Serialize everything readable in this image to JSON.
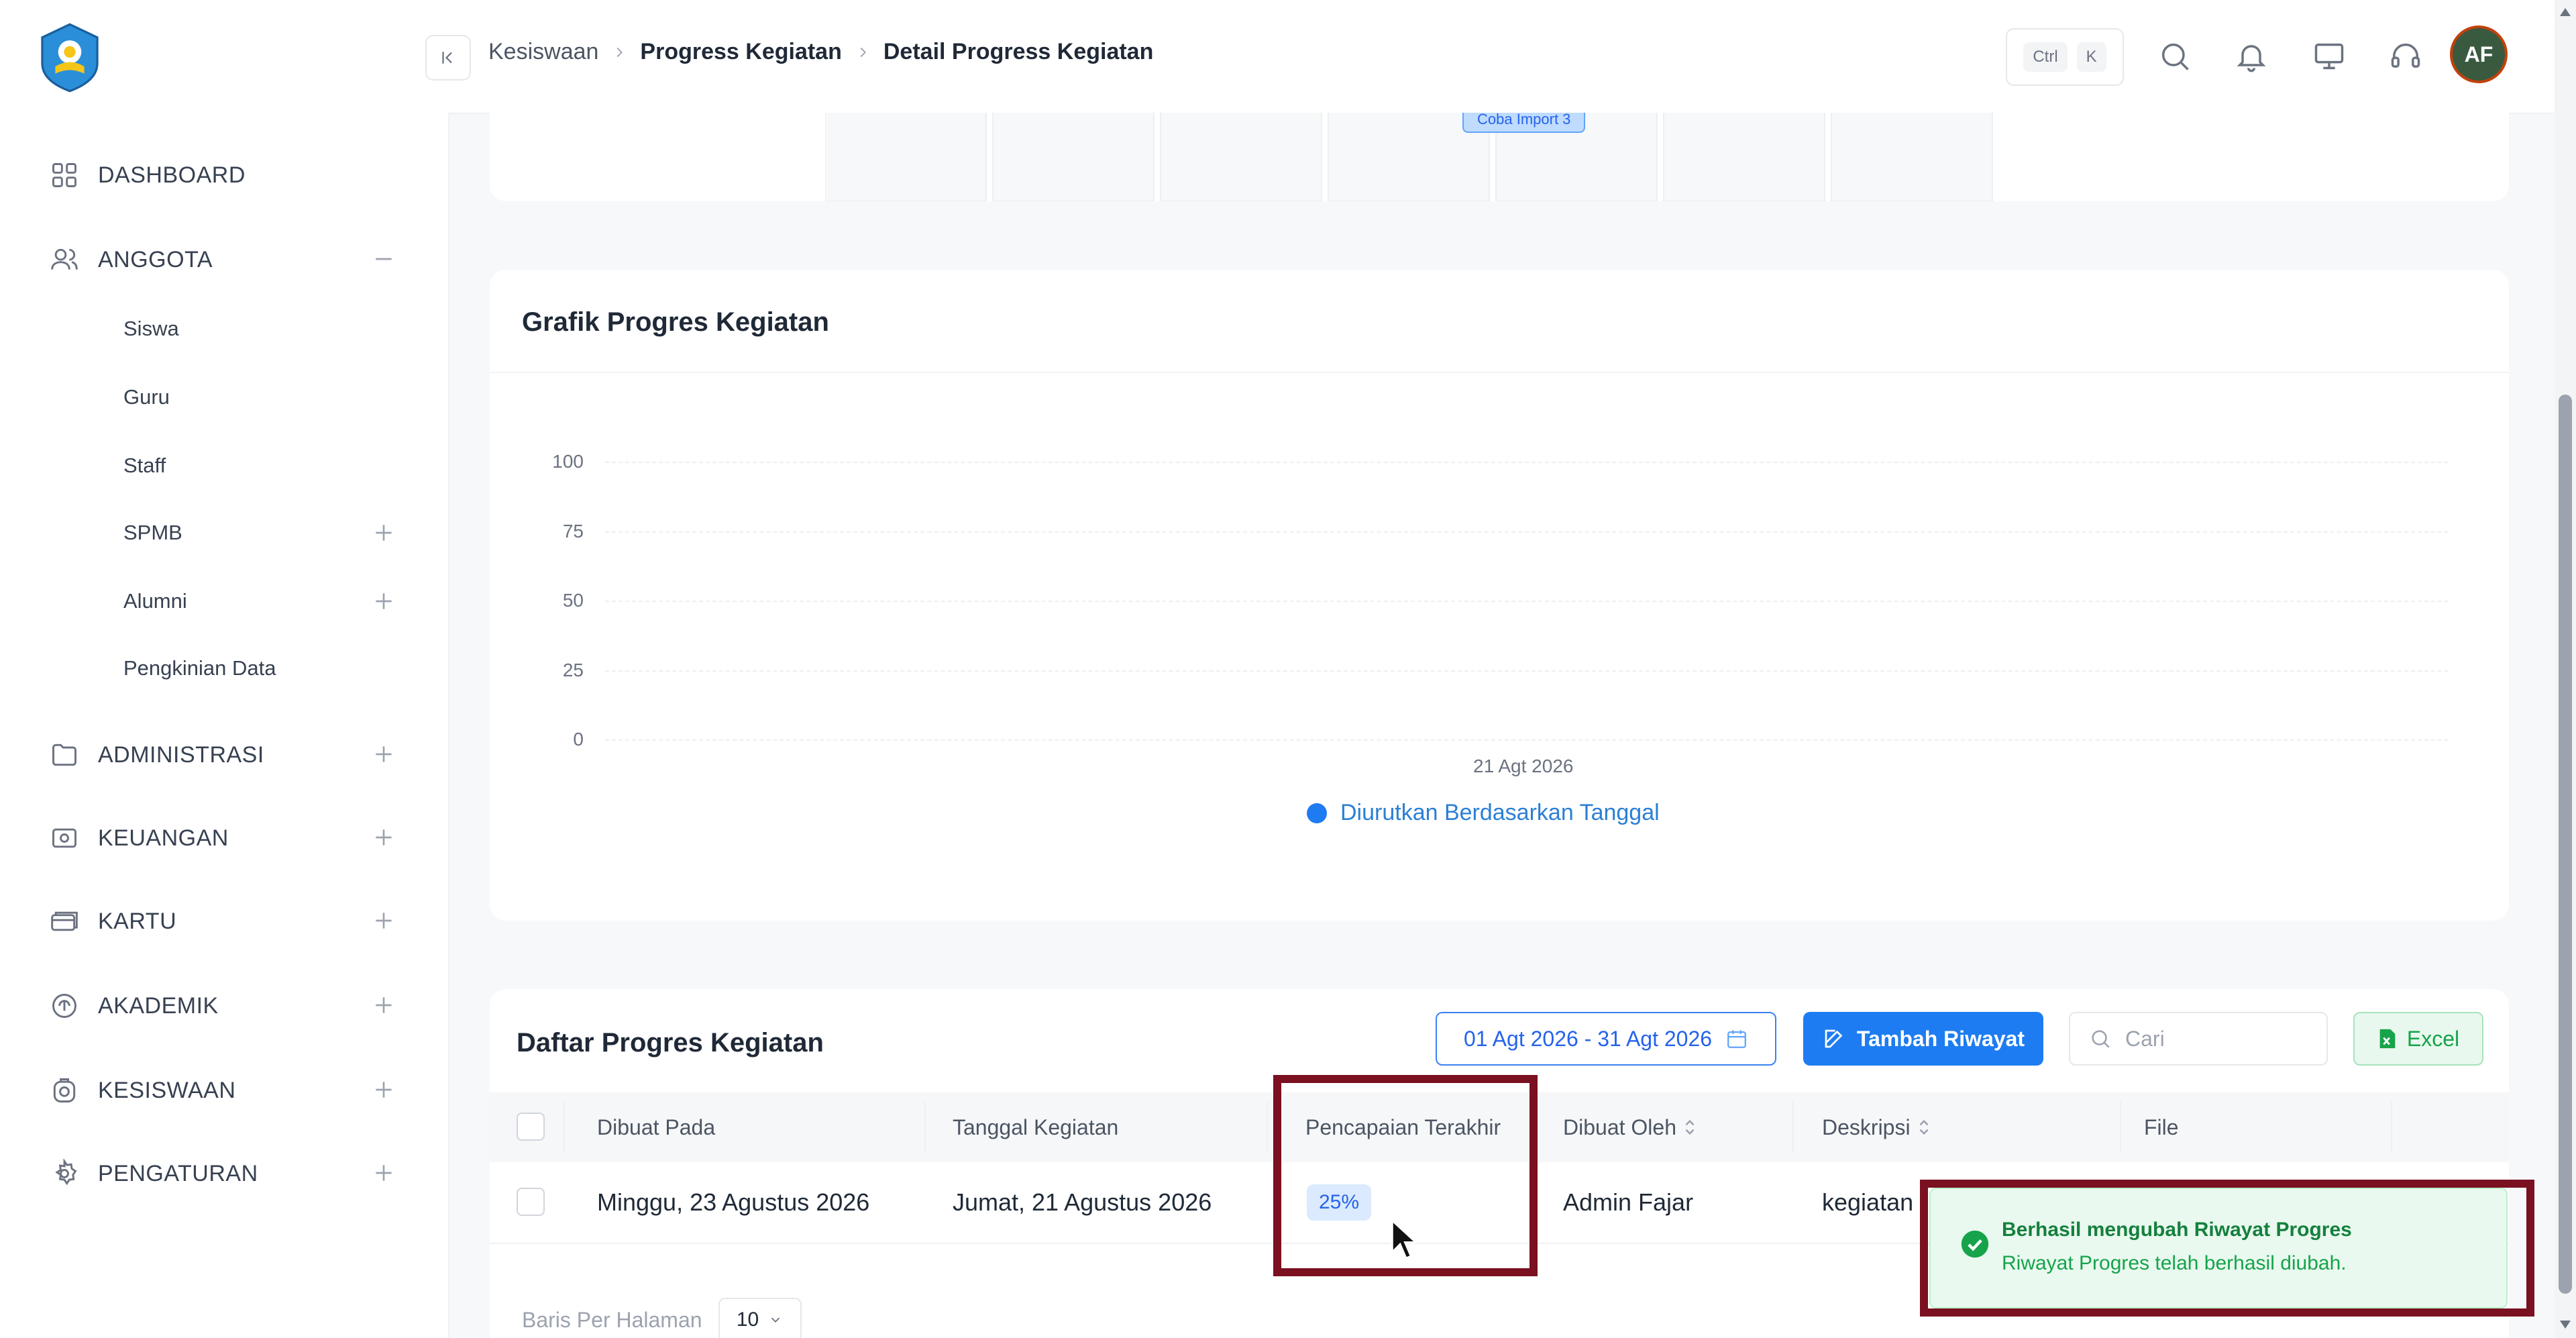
{
  "sidebar": {
    "items": [
      {
        "label": "DASHBOARD",
        "icon": "grid-icon"
      },
      {
        "label": "ANGGOTA",
        "icon": "users-icon",
        "expanded": true
      },
      {
        "label": "ADMINISTRASI",
        "icon": "folder-icon"
      },
      {
        "label": "KEUANGAN",
        "icon": "money-icon"
      },
      {
        "label": "KARTU",
        "icon": "card-icon"
      },
      {
        "label": "AKADEMIK",
        "icon": "academic-icon"
      },
      {
        "label": "KESISWAAN",
        "icon": "student-icon"
      },
      {
        "label": "PENGATURAN",
        "icon": "gear-icon"
      }
    ],
    "anggota_sub": [
      {
        "label": "Siswa"
      },
      {
        "label": "Guru"
      },
      {
        "label": "Staff"
      },
      {
        "label": "SPMB"
      },
      {
        "label": "Alumni"
      },
      {
        "label": "Pengkinian Data"
      }
    ]
  },
  "header": {
    "breadcrumb": [
      "Kesiswaan",
      "Progress Kegiatan",
      "Detail Progress Kegiatan"
    ],
    "shortcut": {
      "key1": "Ctrl",
      "key2": "K"
    },
    "avatar_initials": "AF"
  },
  "top_card": {
    "import_label": "Coba Import 3"
  },
  "chart_card": {
    "title": "Grafik Progres Kegiatan"
  },
  "chart_data": {
    "type": "line",
    "title": "Grafik Progres Kegiatan",
    "x": [
      "21 Agt 2026"
    ],
    "series": [
      {
        "name": "Diurutkan Berdasarkan Tanggal",
        "values": [
          null
        ]
      }
    ],
    "yticks": [
      "100",
      "75",
      "50",
      "25",
      "0"
    ],
    "ylim": [
      0,
      100
    ],
    "grid": true,
    "legend": "bottom-center",
    "color": "#1e7bf2"
  },
  "table": {
    "title": "Daftar Progres Kegiatan",
    "date_range": "01 Agt 2026 - 31 Agt 2026",
    "add_label": "Tambah Riwayat",
    "search_placeholder": "Cari",
    "excel_label": "Excel",
    "columns": [
      "Dibuat Pada",
      "Tanggal Kegiatan",
      "Pencapaian Terakhir",
      "Dibuat Oleh",
      "Deskripsi",
      "File"
    ],
    "rows": [
      {
        "dibuat_pada": "Minggu, 23 Agustus 2026",
        "tanggal": "Jumat, 21 Agustus 2026",
        "pencapaian": "25%",
        "dibuat_oleh": "Admin Fajar",
        "deskripsi": "kegiatan"
      }
    ],
    "rows_per_page_label": "Baris Per Halaman",
    "rows_per_page": "10"
  },
  "toast": {
    "title": "Berhasil mengubah Riwayat Progres",
    "message": "Riwayat Progres telah berhasil diubah."
  },
  "colors": {
    "accent": "#1d7cf2",
    "highlight": "#7a1020",
    "success": "#16a34a"
  }
}
